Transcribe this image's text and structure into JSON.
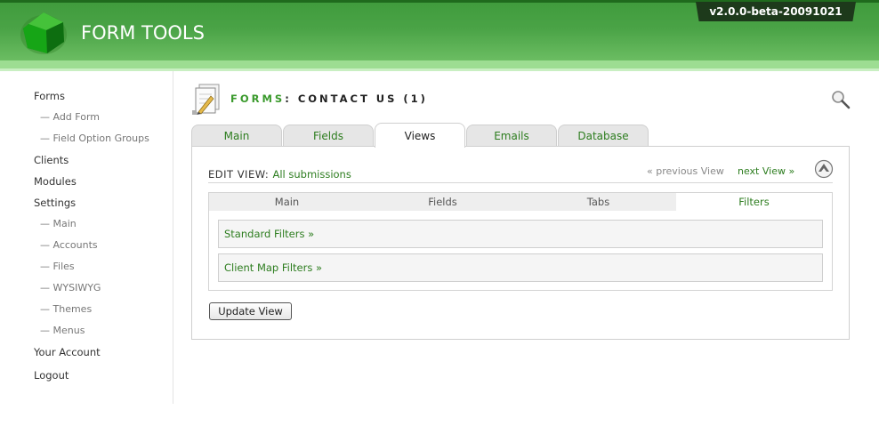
{
  "app": {
    "title": "FORM TOOLS",
    "version": "v2.0.0-beta-20091021"
  },
  "sidebar": {
    "items": [
      {
        "label": "Forms",
        "type": "main"
      },
      {
        "label": "— Add Form",
        "type": "sub"
      },
      {
        "label": "— Field Option Groups",
        "type": "sub"
      },
      {
        "label": "Clients",
        "type": "main"
      },
      {
        "label": "Modules",
        "type": "main"
      },
      {
        "label": "Settings",
        "type": "main"
      },
      {
        "label": "— Main",
        "type": "sub"
      },
      {
        "label": "— Accounts",
        "type": "sub"
      },
      {
        "label": "— Files",
        "type": "sub"
      },
      {
        "label": "— WYSIWYG",
        "type": "sub"
      },
      {
        "label": "— Themes",
        "type": "sub"
      },
      {
        "label": "— Menus",
        "type": "sub"
      },
      {
        "label": "Your Account",
        "type": "main"
      },
      {
        "label": "Logout",
        "type": "main"
      }
    ]
  },
  "page": {
    "title_prefix": "FORMS",
    "title_rest": ": CONTACT US (1)"
  },
  "tabs": [
    {
      "label": "Main",
      "active": false
    },
    {
      "label": "Fields",
      "active": false
    },
    {
      "label": "Views",
      "active": true
    },
    {
      "label": "Emails",
      "active": false
    },
    {
      "label": "Database",
      "active": false
    }
  ],
  "edit_view": {
    "label": "EDIT VIEW:",
    "view_name": "All submissions",
    "prev_label": "« previous View",
    "next_label": "next View »"
  },
  "subtabs": [
    {
      "label": "Main",
      "active": false
    },
    {
      "label": "Fields",
      "active": false
    },
    {
      "label": "Tabs",
      "active": false
    },
    {
      "label": "Filters",
      "active": true
    }
  ],
  "filters": [
    {
      "label": "Standard Filters »"
    },
    {
      "label": "Client Map Filters »"
    }
  ],
  "update_button": "Update View",
  "colors": {
    "brand_green": "#4aa346",
    "link_green": "#2d7d1f",
    "header_dark": "#1d3a1b"
  }
}
